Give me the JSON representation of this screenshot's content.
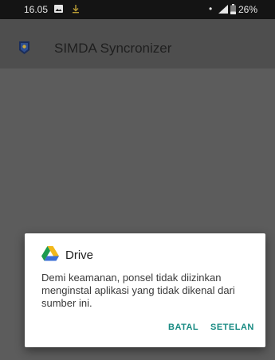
{
  "status_bar": {
    "time": "16.05",
    "dot": "•",
    "battery": "26%",
    "icons": [
      "gallery-icon",
      "download-icon",
      "signal-icon",
      "battery-icon"
    ]
  },
  "app_bar": {
    "title": "SIMDA Syncronizer",
    "logo_icon": "app-logo-icon"
  },
  "dialog": {
    "icon": "google-drive-icon",
    "title": "Drive",
    "message": "Demi keamanan, ponsel tidak diizinkan menginstal aplikasi yang tidak dikenal dari sumber ini.",
    "cancel_label": "BATAL",
    "settings_label": "SETELAN"
  },
  "colors": {
    "accent": "#178a82",
    "scrim": "#5c5c5c",
    "app_bar": "#4e4e4e",
    "status_bar": "#141414",
    "drive_yellow": "#f2b81a",
    "drive_green": "#1c9b4f",
    "drive_blue": "#3b6fd6"
  }
}
